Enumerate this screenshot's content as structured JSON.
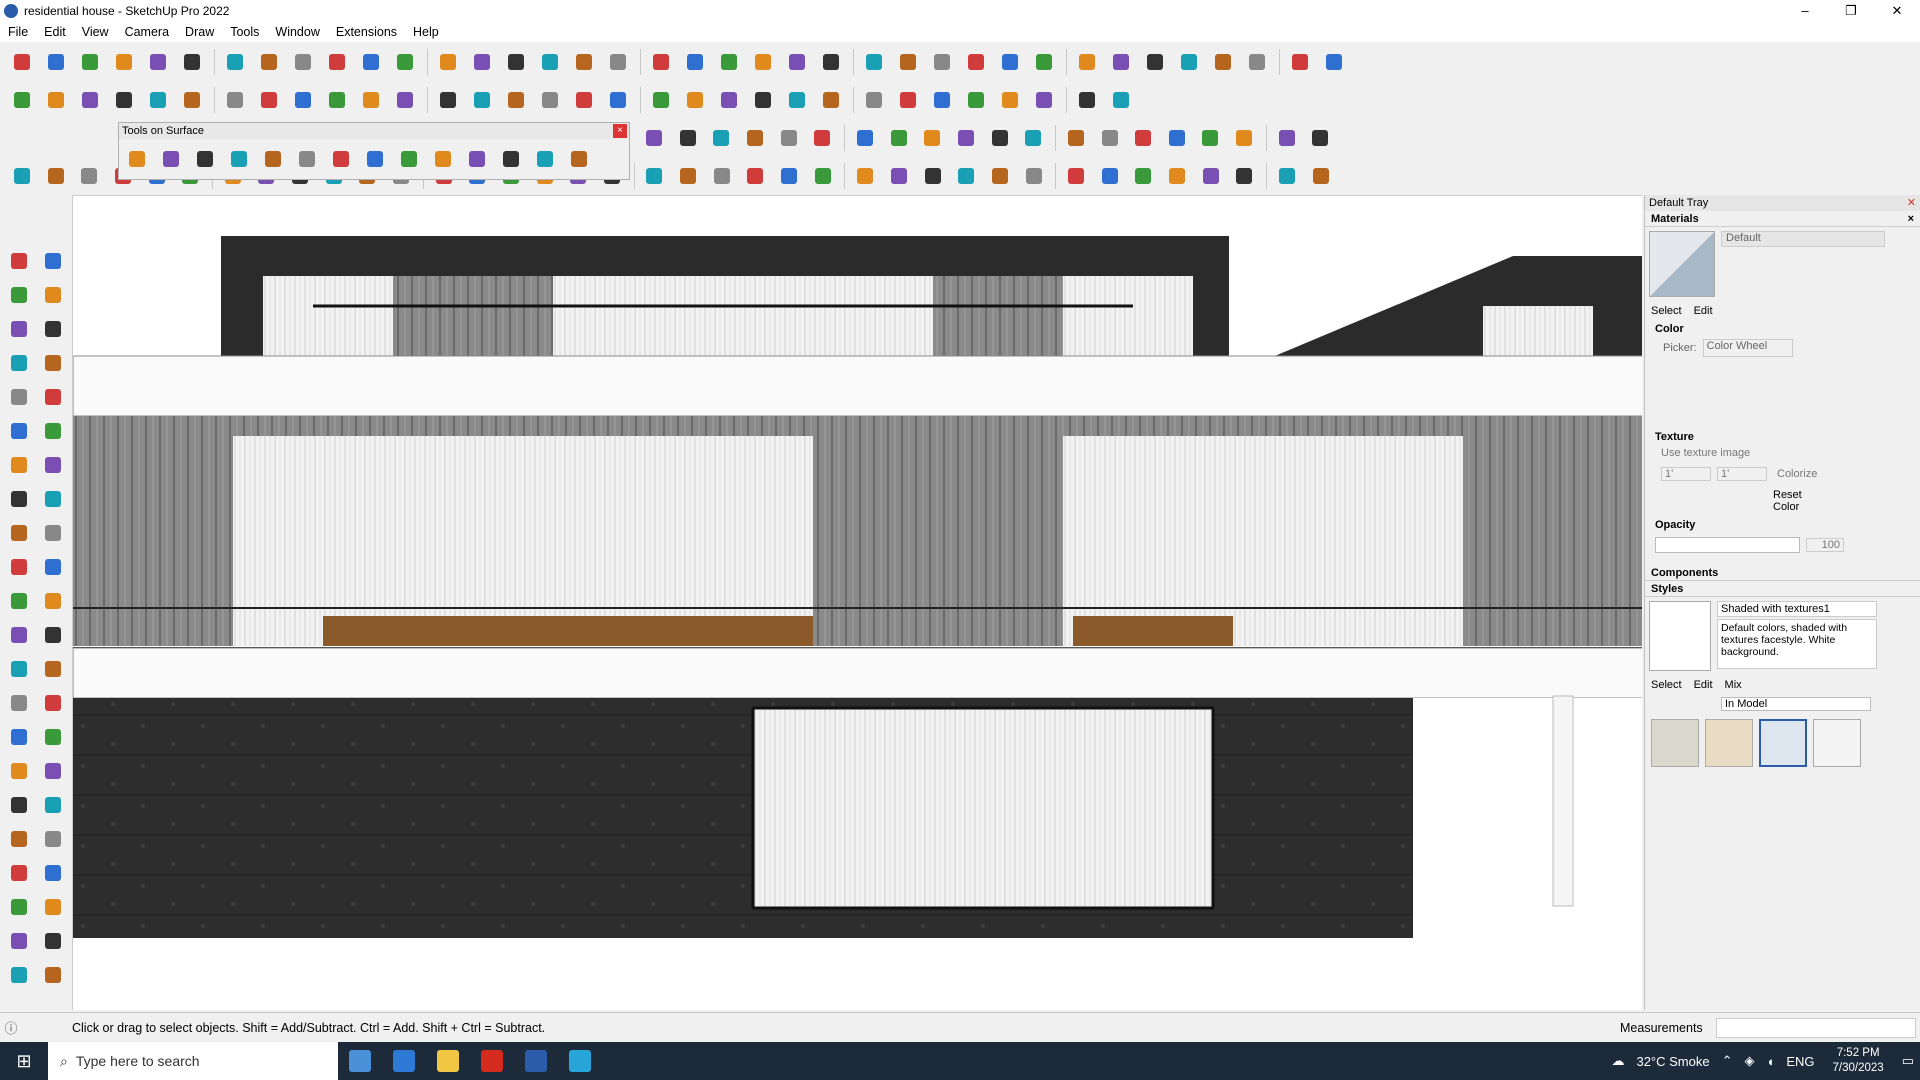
{
  "window": {
    "title": "residential house - SketchUp Pro 2022",
    "controls": [
      "–",
      "❐",
      "✕"
    ]
  },
  "menu": [
    "File",
    "Edit",
    "View",
    "Camera",
    "Draw",
    "Tools",
    "Window",
    "Extensions",
    "Help"
  ],
  "floating_toolbar": {
    "title": "Tools on Surface",
    "close": "×"
  },
  "tray": {
    "title": "Default Tray",
    "materials": {
      "header": "Materials",
      "material_name": "Default",
      "tabs": [
        "Select",
        "Edit"
      ],
      "color_label": "Color",
      "picker_label": "Picker:",
      "picker_value": "Color Wheel",
      "texture_label": "Texture",
      "use_texture_label": "Use texture image",
      "width_value": "1'",
      "height_value": "1'",
      "colorize_label": "Colorize",
      "reset_color_label": "Reset Color",
      "opacity_label": "Opacity",
      "opacity_value": "100"
    },
    "components": {
      "header": "Components"
    },
    "styles": {
      "header": "Styles",
      "style_name": "Shaded with textures1",
      "description": "Default colors, shaded with textures facestyle. White background.",
      "tabs": [
        "Select",
        "Edit",
        "Mix"
      ],
      "collection": "In Model"
    }
  },
  "status": {
    "message": "Click or drag to select objects. Shift = Add/Subtract. Ctrl = Add. Shift + Ctrl = Subtract.",
    "measurements_label": "Measurements",
    "measurements_value": ""
  },
  "taskbar": {
    "search_placeholder": "Type here to search",
    "weather": "32°C  Smoke",
    "language": "ENG",
    "time": "7:52 PM",
    "date": "7/30/2023"
  },
  "colors": {
    "accent": "#2a5caa",
    "taskbar": "#1c2a3a",
    "facade_dark": "#2b2b2b",
    "glass": "#e8e8e8"
  }
}
